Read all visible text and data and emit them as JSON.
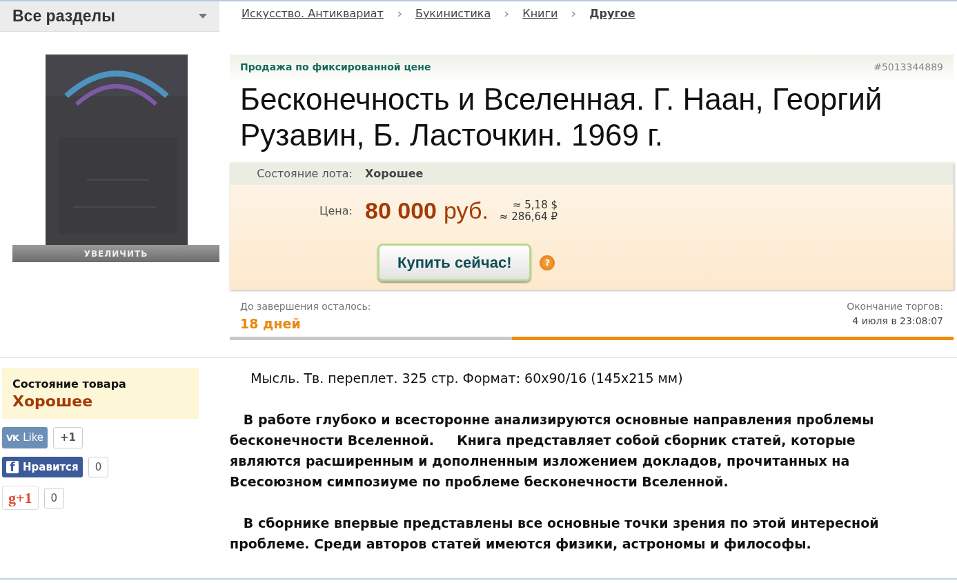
{
  "category_menu": {
    "label": "Все разделы"
  },
  "breadcrumbs": [
    {
      "label": "Искусство. Антиквариат",
      "current": false
    },
    {
      "label": "Букинистика",
      "current": false
    },
    {
      "label": "Книги",
      "current": false
    },
    {
      "label": "Другое",
      "current": true
    }
  ],
  "gallery": {
    "zoom_label": "УВЕЛИЧИТЬ"
  },
  "lot": {
    "sale_type": "Продажа по фиксированной цене",
    "number": "#5013344889",
    "title": "Бесконечность и Вселенная. Г. Наан, Георгий Рузавин, Б. Ласточкин. 1969 г.",
    "condition_label": "Состояние лота:",
    "condition": "Хорошее",
    "price_label": "Цена:",
    "price_amount": "80 000",
    "price_currency": "руб.",
    "conversions": [
      "≈ 5,18 $",
      "≈ 286,64 ₽"
    ],
    "buy_button": "Купить сейчас!",
    "help_icon": "?",
    "remaining_label": "До завершения осталось:",
    "remaining": "18 дней",
    "end_label": "Окончание торгов:",
    "end_time": "4 июля в 23:08:07",
    "time_progress": {
      "level": 0.61
    }
  },
  "item_condition": {
    "label": "Состояние товара",
    "value": "Хорошее"
  },
  "social": [
    {
      "kind": "vk",
      "logo": "VK",
      "label": "Like",
      "count": "+1"
    },
    {
      "kind": "facebook",
      "logo": "f",
      "label": "Нравится",
      "count": "0"
    },
    {
      "kind": "gplus",
      "logo": "g+1",
      "count": "0"
    }
  ],
  "description": [
    {
      "bold": false,
      "text": "     Мысль. Тв. переплет. 325 стр. Формат: 60х90/16 (145х215 мм)"
    },
    {
      "bold": true,
      "text": "   В работе глубоко и всесторонне анализируются основные направления проблемы бесконечности Вселенной.     Книга представляет собой сборник статей, которые являются расширенным и дополненным изложением докладов, прочитанных на Всесоюзном симпозиуме по проблеме бесконечности Вселенной."
    },
    {
      "bold": true,
      "text": "   В сборнике впервые представлены все основные точки зрения по этой интересной проблеме. Среди авторов статей имеются физики, астрономы и философы."
    }
  ]
}
